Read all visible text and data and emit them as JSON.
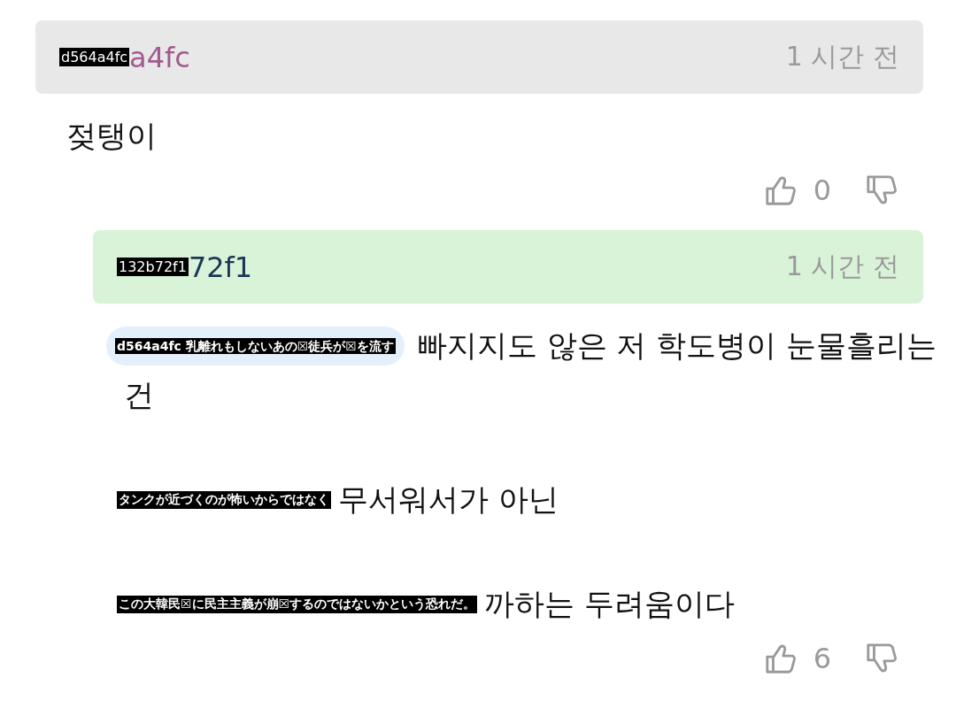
{
  "comments": [
    {
      "reply": false,
      "author": {
        "overlay": "d564a4fc",
        "visible": "a4fc"
      },
      "time": "1 시간 전",
      "paragraphs": [
        {
          "lines": [
            {
              "text": "젖탱이"
            }
          ]
        }
      ],
      "likes": "0"
    },
    {
      "reply": true,
      "author": {
        "overlay": "132b72f1",
        "visible": "72f1"
      },
      "time": "1 시간 전",
      "paragraphs": [
        {
          "lines": [
            {
              "mention": true,
              "overlay": "d564a4fc 乳離れもしないあの☒徒兵が☒を流す",
              "text": "빠지지도 않은 저 학도병이 눈물흘리는"
            },
            {
              "text": "건"
            }
          ]
        },
        {
          "lines": [
            {
              "overlay": "タンクが近づくのが怖いからではなく",
              "text": "무서워서가 아닌"
            }
          ]
        },
        {
          "lines": [
            {
              "overlay": "この大韓民☒に民主主義が崩☒するのではないかという恐れだ。",
              "text": "까하는 두려움이다"
            }
          ]
        }
      ],
      "likes": "6"
    }
  ]
}
